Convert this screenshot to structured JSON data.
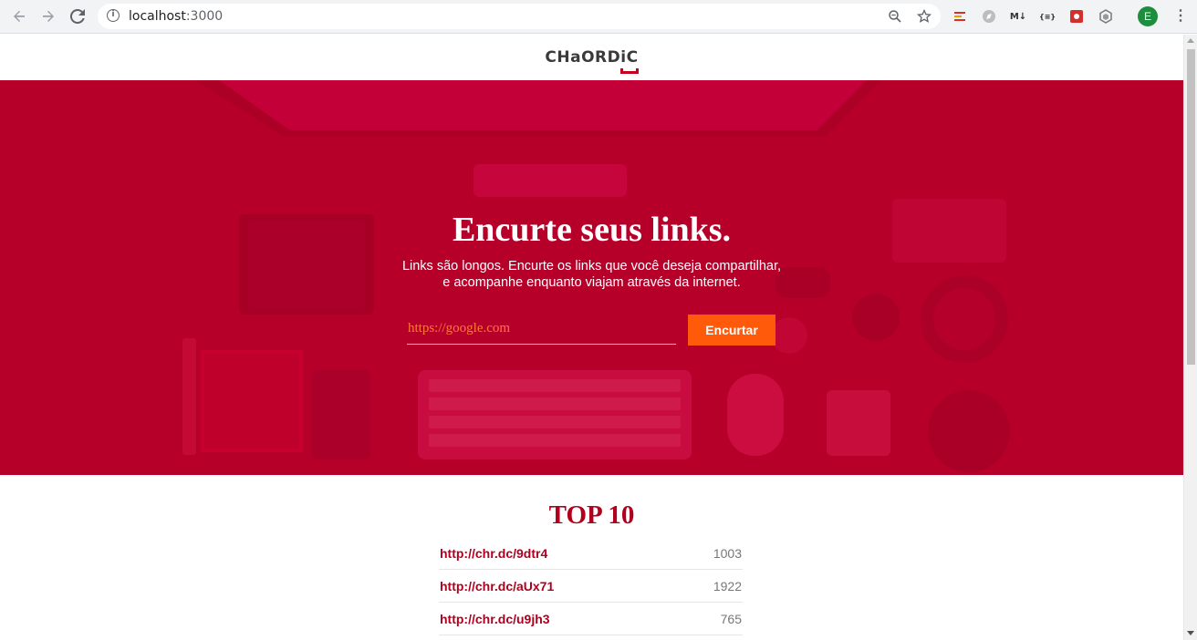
{
  "browser": {
    "url_host": "localhost",
    "url_port": ":3000",
    "profile_initial": "E",
    "extensions": [
      "extension-1-icon",
      "extension-2-icon",
      "markdown-extension-icon",
      "json-extension-icon",
      "extension-5-icon",
      "extension-6-icon"
    ],
    "ext_labels": {
      "markdown": "M↓",
      "json": "{≡}"
    }
  },
  "header": {
    "logo_text": "CHaORDiC"
  },
  "hero": {
    "title": "Encurte seus links.",
    "subtitle_line1": "Links são longos. Encurte os links que você deseja compartilhar,",
    "subtitle_line2": "e acompanhe enquanto viajam através da internet.",
    "input_placeholder": "https://google.com",
    "button_label": "Encurtar",
    "colors": {
      "overlay": "#b8002a",
      "button": "#ff5a0a"
    }
  },
  "top10": {
    "title": "TOP 10",
    "items": [
      {
        "url": "http://chr.dc/9dtr4",
        "count": "1003"
      },
      {
        "url": "http://chr.dc/aUx71",
        "count": "1922"
      },
      {
        "url": "http://chr.dc/u9jh3",
        "count": "765"
      }
    ]
  }
}
